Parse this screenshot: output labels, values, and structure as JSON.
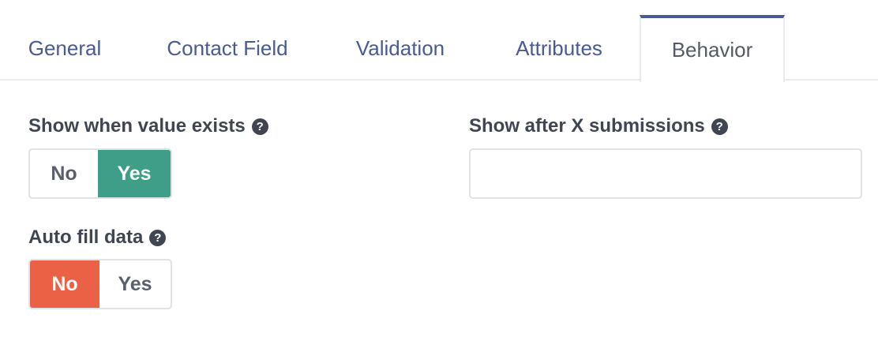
{
  "tabs": [
    {
      "label": "General"
    },
    {
      "label": "Contact Field"
    },
    {
      "label": "Validation"
    },
    {
      "label": "Attributes"
    },
    {
      "label": "Behavior",
      "active": true
    }
  ],
  "fields": {
    "show_when_value_exists": {
      "label": "Show when value exists",
      "no_label": "No",
      "yes_label": "Yes",
      "selected": "Yes"
    },
    "auto_fill_data": {
      "label": "Auto fill data",
      "no_label": "No",
      "yes_label": "Yes",
      "selected": "No"
    },
    "show_after_x_submissions": {
      "label": "Show after X submissions",
      "value": ""
    }
  },
  "help_icon_glyph": "?",
  "colors": {
    "tab_active_accent": "#4a5a93",
    "yes_selected": "#3f9e88",
    "no_selected": "#ea6145"
  }
}
